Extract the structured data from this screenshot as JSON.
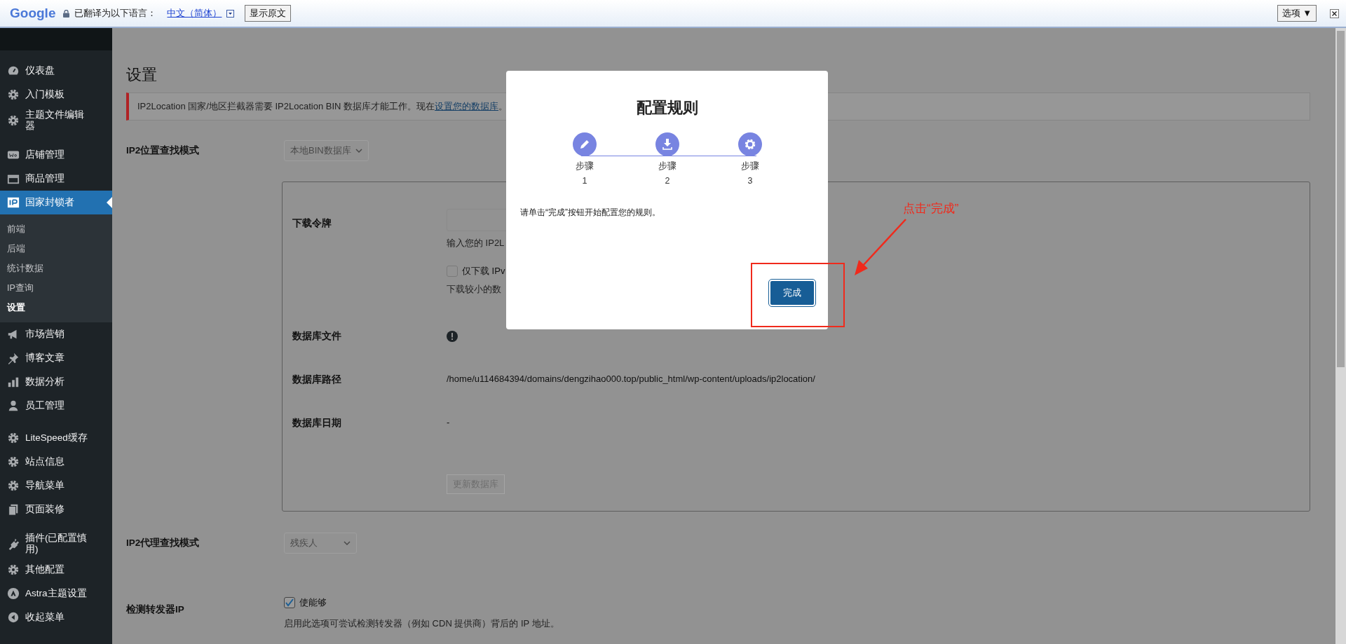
{
  "translate_bar": {
    "logo": "Google",
    "prompt": "已翻译为以下语言：",
    "language": "中文（简体）",
    "show_original_button": "显示原文",
    "options_button": "选项 ▼"
  },
  "sidebar": {
    "groups": [
      {
        "items": [
          {
            "label": "仪表盘",
            "kind": "gauge",
            "selected": false
          },
          {
            "label": "入门模板",
            "kind": "gear",
            "selected": false
          },
          {
            "label": "主题文件编辑器",
            "kind": "gear",
            "selected": false
          }
        ]
      },
      {
        "items": [
          {
            "label": "店铺管理",
            "kind": "woo",
            "selected": false
          },
          {
            "label": "商品管理",
            "kind": "archive",
            "selected": false
          },
          {
            "label": "国家封锁者",
            "kind": "ip",
            "selected": true,
            "children": [
              {
                "label": "前端",
                "selected": false
              },
              {
                "label": "后端",
                "selected": false
              },
              {
                "label": "统计数据",
                "selected": false
              },
              {
                "label": "IP查询",
                "selected": false
              },
              {
                "label": "设置",
                "selected": true
              }
            ]
          },
          {
            "label": "市场营销",
            "kind": "megaphone",
            "selected": false
          },
          {
            "label": "博客文章",
            "kind": "pin",
            "selected": false
          },
          {
            "label": "数据分析",
            "kind": "chart",
            "selected": false
          },
          {
            "label": "员工管理",
            "kind": "person",
            "selected": false
          }
        ]
      },
      {
        "items": [
          {
            "label": "LiteSpeed缓存",
            "kind": "gear",
            "selected": false
          },
          {
            "label": "站点信息",
            "kind": "gear",
            "selected": false
          },
          {
            "label": "导航菜单",
            "kind": "gear",
            "selected": false
          },
          {
            "label": "页面装修",
            "kind": "pages",
            "selected": false
          }
        ]
      },
      {
        "items": [
          {
            "label": "插件(已配置慎用)",
            "kind": "plug",
            "selected": false
          },
          {
            "label": "其他配置",
            "kind": "gear",
            "selected": false
          },
          {
            "label": "Astra主题设置",
            "kind": "astra",
            "selected": false
          },
          {
            "label": "收起菜单",
            "kind": "collapse",
            "selected": false
          }
        ]
      }
    ]
  },
  "page_title": "设置",
  "notice": {
    "text": "IP2Location 国家/地区拦截器需要 IP2Location BIN 数据库才能工作。现在",
    "link": "设置您的数据库",
    "text_after": "。"
  },
  "lookup_mode": {
    "label": "IP2位置查找模式",
    "value": "本地BIN数据库",
    "disabled": true
  },
  "database_panel": {
    "token_label": "下载令牌",
    "token_help": "输入您的 IP2L",
    "ipv4_checkbox": {
      "label": "仅下载 IPv",
      "checked": false
    },
    "ipv4_help": "下载较小的数",
    "file_label": "数据库文件",
    "path_label": "数据库路径",
    "path_value": "/home/u114684394/domains/dengzihao000.top/public_html/wp-content/uploads/ip2location/",
    "date_label": "数据库日期",
    "date_value": "-",
    "update_button": {
      "label": "更新数据库",
      "disabled": true
    }
  },
  "proxy_mode": {
    "label": "IP2代理查找模式",
    "value": "残疾人",
    "disabled": true
  },
  "forwarder": {
    "label": "检测转发器IP",
    "checkbox": {
      "label": "使能够",
      "checked": true
    },
    "help": "启用此选项可尝试检测转发器（例如 CDN 提供商）背后的 IP 地址。"
  },
  "modal": {
    "title": "配置规则",
    "steps": [
      {
        "kind": "pencil",
        "label": "步骤",
        "number": "1"
      },
      {
        "kind": "download",
        "label": "步骤",
        "number": "2"
      },
      {
        "kind": "gear",
        "label": "步骤",
        "number": "3"
      }
    ],
    "message": "请单击“完成”按钮开始配置您的规则。",
    "button": "完成"
  },
  "annotation": {
    "text": "点击“完成”"
  }
}
